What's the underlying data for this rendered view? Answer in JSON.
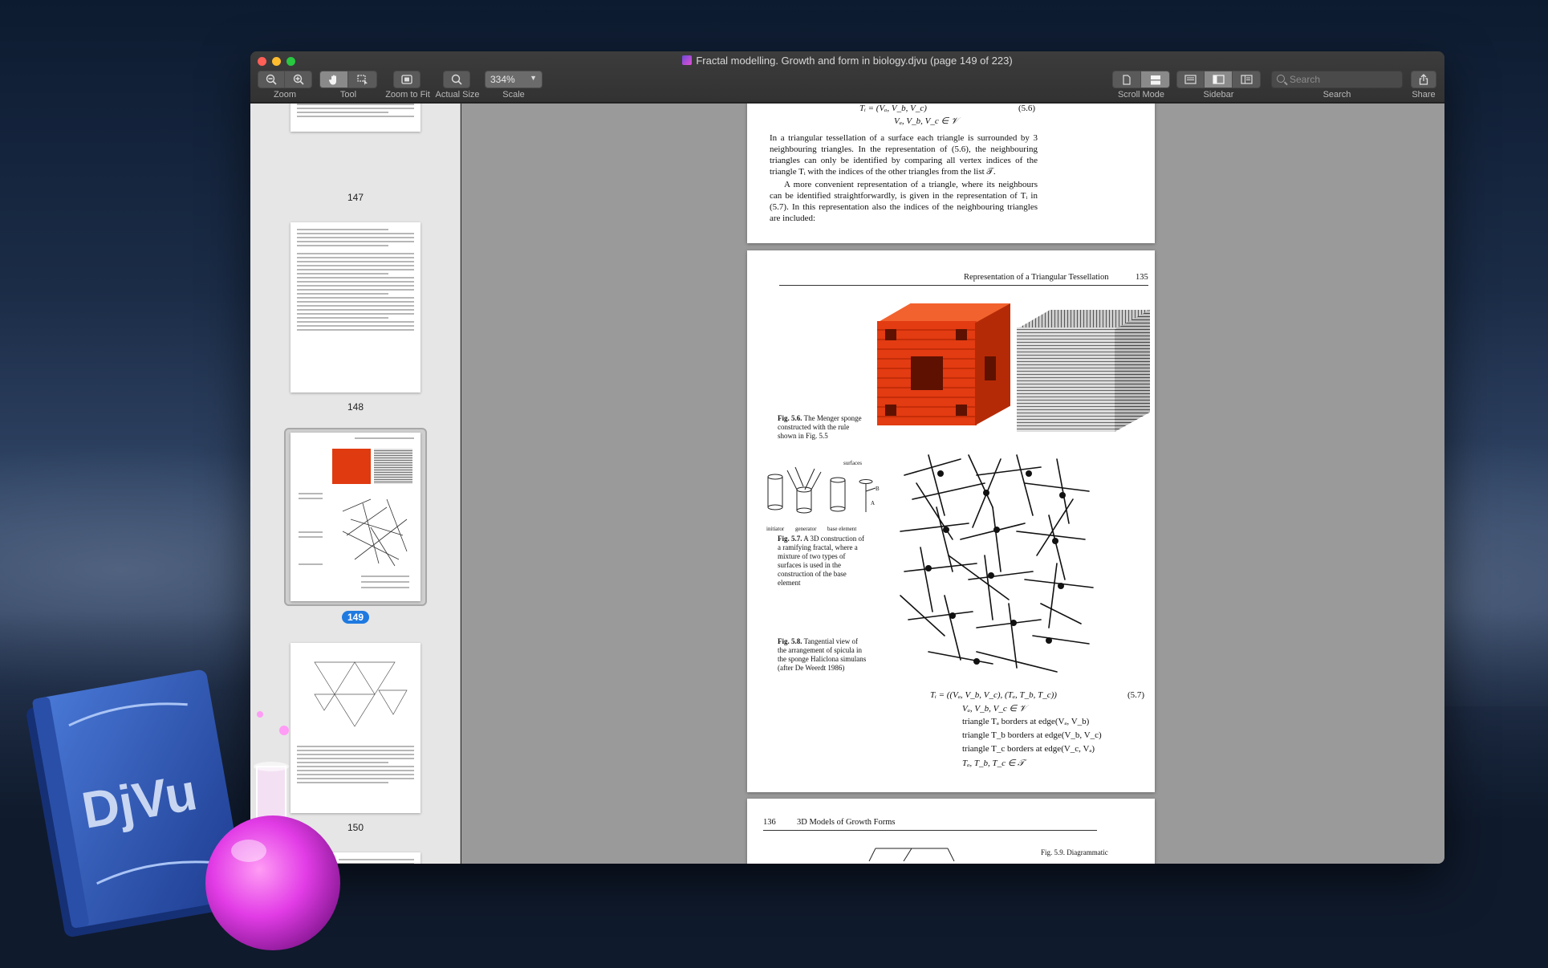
{
  "window": {
    "title": "Fractal modelling. Growth and form in biology.djvu (page 149 of 223)"
  },
  "toolbar": {
    "zoom_label": "Zoom",
    "tool_label": "Tool",
    "zoom_to_fit_label": "Zoom to Fit",
    "actual_size_label": "Actual Size",
    "scale_label": "Scale",
    "scale_value": "334%",
    "scroll_mode_label": "Scroll Mode",
    "sidebar_label": "Sidebar",
    "search_label": "Search",
    "search_placeholder": "Search",
    "share_label": "Share"
  },
  "sidebar": {
    "pages": [
      {
        "label": "147"
      },
      {
        "label": "148"
      },
      {
        "label": "149"
      },
      {
        "label": "150"
      }
    ],
    "selected_page": "149"
  },
  "page148_bottom": {
    "eq_line1": "Tᵢ  =  (Vₐ, V_b, V_c)",
    "eq_number": "(5.6)",
    "eq_line2": "Vₐ, V_b, V_c ∈ 𝒱",
    "para1": "In a triangular tessellation of a surface each triangle is surrounded by 3 neighbouring triangles. In the representation of (5.6), the neighbouring triangles can only be identified by comparing all vertex indices of the triangle Tᵢ with the indices of the other triangles from the list 𝒯.",
    "para2": "A more convenient representation of a triangle, where its neighbours can be identified straightforwardly, is given in the representation of Tᵢ in (5.7). In this representation also the indices of the neighbouring triangles are included:"
  },
  "page149": {
    "running_head": "Representation of a Triangular Tessellation",
    "page_number": "135",
    "fig56_caption_label": "Fig. 5.6.",
    "fig56_caption": "The Menger sponge constructed with the rule shown in Fig. 5.5",
    "fig57_labels": {
      "initiator": "initiator",
      "generator": "generator",
      "base_element": "base element",
      "surfaces": "surfaces",
      "b": "B",
      "a": "A"
    },
    "fig57_caption_label": "Fig. 5.7.",
    "fig57_caption": "A 3D construction of a ramifying fractal, where a mixture of two types of surfaces is used in the construction of the base element",
    "fig58_caption_label": "Fig. 5.8.",
    "fig58_caption": "Tangential view of the arrangement of spicula in the sponge Haliclona simulans (after De Weerdt 1986)",
    "eq57": {
      "line1": "Tᵢ  =  ((Vₐ, V_b, V_c), (Tₐ, T_b, T_c))",
      "number": "(5.7)",
      "line2": "Vₐ, V_b, V_c ∈ 𝒱",
      "line3": "triangle Tₐ borders at edge(Vₐ, V_b)",
      "line4": "triangle T_b borders at edge(V_b, V_c)",
      "line5": "triangle T_c borders at edge(V_c, Vₐ)",
      "line6": "Tₐ, T_b, T_c ∈ 𝒯"
    }
  },
  "page150_top": {
    "page_number": "136",
    "running_head": "3D Models of Growth Forms",
    "fig59_caption": "Fig. 5.9. Diagrammatic"
  },
  "app_icon": {
    "book_text": "DjVu"
  },
  "colors": {
    "selection_badge": "#1f7ae0",
    "menger_red": "#e03a10",
    "book_blue": "#2f56b5",
    "flask_magenta": "#e23ce6"
  }
}
